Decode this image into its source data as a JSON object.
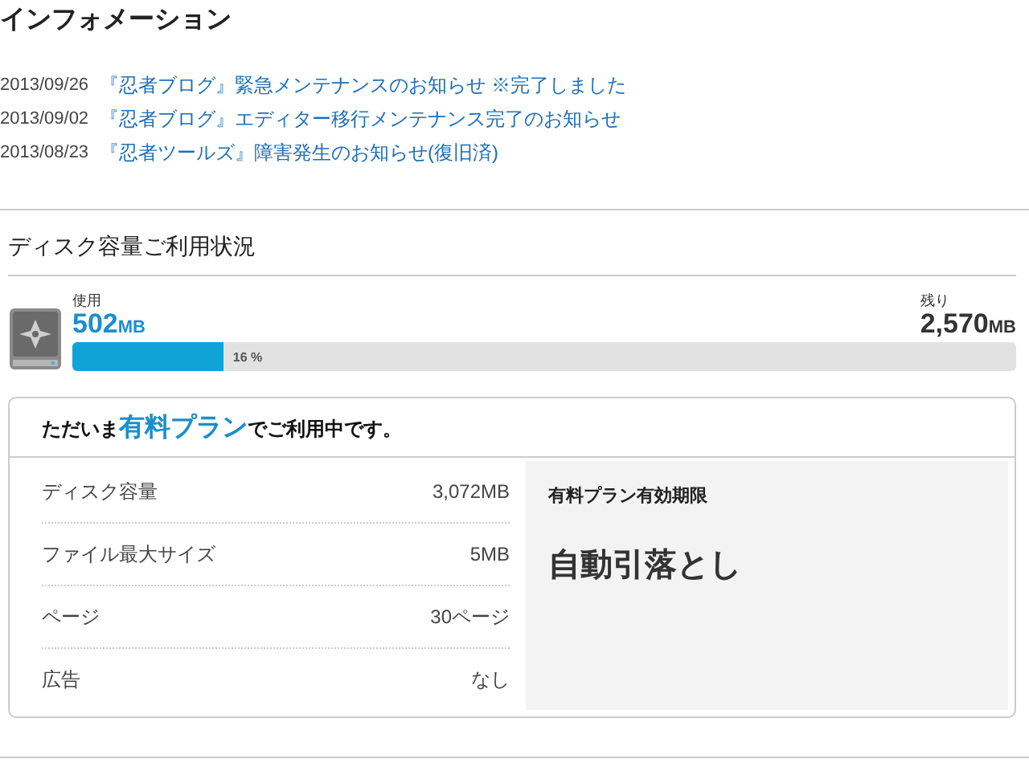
{
  "info": {
    "title": "インフォメーション",
    "news": [
      {
        "date": "2013/09/26",
        "text": "『忍者ブログ』緊急メンテナンスのお知らせ ※完了しました"
      },
      {
        "date": "2013/09/02",
        "text": "『忍者ブログ』エディター移行メンテナンス完了のお知らせ"
      },
      {
        "date": "2013/08/23",
        "text": "『忍者ツールズ』障害発生のお知らせ(復旧済)"
      }
    ]
  },
  "disk": {
    "title": "ディスク容量ご利用状況",
    "used_label": "使用",
    "used_value": "502",
    "used_unit": "MB",
    "remaining_label": "残り",
    "remaining_value": "2,570",
    "remaining_unit": "MB",
    "level": 0.16,
    "percent": "16 %"
  },
  "plan": {
    "heading_before": "ただいま",
    "heading_highlight": "有料プラン",
    "heading_after": "でご利用中です。",
    "specs": [
      {
        "label": "ディスク容量",
        "value": "3,072MB"
      },
      {
        "label": "ファイル最大サイズ",
        "value": "5MB"
      },
      {
        "label": "ページ",
        "value": "30ページ"
      },
      {
        "label": "広告",
        "value": "なし"
      }
    ],
    "expiry_label": "有料プラン有効期限",
    "expiry_value": "自動引落とし"
  }
}
